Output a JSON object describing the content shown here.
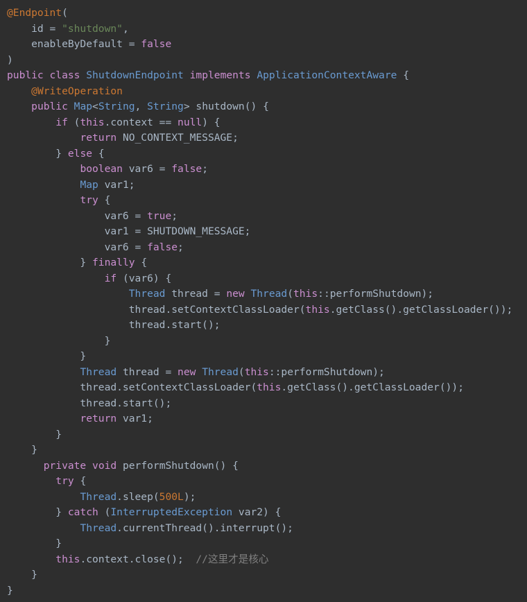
{
  "editor": {
    "language": "Java",
    "theme": "darcula",
    "background_color": "#2e2e2e",
    "colors": {
      "plain": "#a9b7c6",
      "keyword": "#cb8fd0",
      "type": "#6a9bd1",
      "annotation": "#cc7832",
      "string": "#6a8759",
      "number": "#cc7832",
      "comment": "#808080"
    }
  },
  "code": {
    "lines": [
      {
        "index": 1,
        "text": "@Endpoint(",
        "tokens": [
          {
            "t": "@Endpoint",
            "k": "anno"
          },
          {
            "t": "(",
            "k": "punct"
          }
        ]
      },
      {
        "index": 2,
        "text": "    id = \"shutdown\",",
        "tokens": [
          {
            "t": "    id = ",
            "k": "plain"
          },
          {
            "t": "\"shutdown\"",
            "k": "string"
          },
          {
            "t": ",",
            "k": "punct"
          }
        ]
      },
      {
        "index": 3,
        "text": "    enableByDefault = false",
        "tokens": [
          {
            "t": "    enableByDefault = ",
            "k": "plain"
          },
          {
            "t": "false",
            "k": "keyword"
          }
        ]
      },
      {
        "index": 4,
        "text": ")",
        "tokens": [
          {
            "t": ")",
            "k": "punct"
          }
        ]
      },
      {
        "index": 5,
        "text": "public class ShutdownEndpoint implements ApplicationContextAware {",
        "tokens": [
          {
            "t": "public",
            "k": "keyword"
          },
          {
            "t": " ",
            "k": "plain"
          },
          {
            "t": "class",
            "k": "keyword"
          },
          {
            "t": " ",
            "k": "plain"
          },
          {
            "t": "ShutdownEndpoint",
            "k": "type"
          },
          {
            "t": " ",
            "k": "plain"
          },
          {
            "t": "implements",
            "k": "keyword"
          },
          {
            "t": " ",
            "k": "plain"
          },
          {
            "t": "ApplicationContextAware",
            "k": "type"
          },
          {
            "t": " {",
            "k": "punct"
          }
        ]
      },
      {
        "index": 6,
        "text": "    @WriteOperation",
        "tokens": [
          {
            "t": "    ",
            "k": "plain"
          },
          {
            "t": "@WriteOperation",
            "k": "anno"
          }
        ]
      },
      {
        "index": 7,
        "text": "    public Map<String, String> shutdown() {",
        "tokens": [
          {
            "t": "    ",
            "k": "plain"
          },
          {
            "t": "public",
            "k": "keyword"
          },
          {
            "t": " ",
            "k": "plain"
          },
          {
            "t": "Map",
            "k": "type"
          },
          {
            "t": "<",
            "k": "punct"
          },
          {
            "t": "String",
            "k": "type"
          },
          {
            "t": ", ",
            "k": "punct"
          },
          {
            "t": "String",
            "k": "type"
          },
          {
            "t": "> shutdown() {",
            "k": "plain"
          }
        ]
      },
      {
        "index": 8,
        "text": "        if (this.context == null) {",
        "tokens": [
          {
            "t": "        ",
            "k": "plain"
          },
          {
            "t": "if",
            "k": "keyword"
          },
          {
            "t": " (",
            "k": "punct"
          },
          {
            "t": "this",
            "k": "keyword"
          },
          {
            "t": ".context == ",
            "k": "plain"
          },
          {
            "t": "null",
            "k": "keyword"
          },
          {
            "t": ") {",
            "k": "punct"
          }
        ]
      },
      {
        "index": 9,
        "text": "            return NO_CONTEXT_MESSAGE;",
        "tokens": [
          {
            "t": "            ",
            "k": "plain"
          },
          {
            "t": "return",
            "k": "keyword"
          },
          {
            "t": " NO_CONTEXT_MESSAGE;",
            "k": "plain"
          }
        ]
      },
      {
        "index": 10,
        "text": "        } else {",
        "tokens": [
          {
            "t": "        } ",
            "k": "plain"
          },
          {
            "t": "else",
            "k": "keyword"
          },
          {
            "t": " {",
            "k": "punct"
          }
        ]
      },
      {
        "index": 11,
        "text": "            boolean var6 = false;",
        "tokens": [
          {
            "t": "            ",
            "k": "plain"
          },
          {
            "t": "boolean",
            "k": "keyword"
          },
          {
            "t": " var6 = ",
            "k": "plain"
          },
          {
            "t": "false",
            "k": "keyword"
          },
          {
            "t": ";",
            "k": "punct"
          }
        ]
      },
      {
        "index": 12,
        "text": "            Map var1;",
        "tokens": [
          {
            "t": "            ",
            "k": "plain"
          },
          {
            "t": "Map",
            "k": "type"
          },
          {
            "t": " var1;",
            "k": "plain"
          }
        ]
      },
      {
        "index": 13,
        "text": "            try {",
        "tokens": [
          {
            "t": "            ",
            "k": "plain"
          },
          {
            "t": "try",
            "k": "keyword"
          },
          {
            "t": " {",
            "k": "punct"
          }
        ]
      },
      {
        "index": 14,
        "text": "                var6 = true;",
        "tokens": [
          {
            "t": "                var6 = ",
            "k": "plain"
          },
          {
            "t": "true",
            "k": "keyword"
          },
          {
            "t": ";",
            "k": "punct"
          }
        ]
      },
      {
        "index": 15,
        "text": "                var1 = SHUTDOWN_MESSAGE;",
        "tokens": [
          {
            "t": "                var1 = SHUTDOWN_MESSAGE;",
            "k": "plain"
          }
        ]
      },
      {
        "index": 16,
        "text": "                var6 = false;",
        "tokens": [
          {
            "t": "                var6 = ",
            "k": "plain"
          },
          {
            "t": "false",
            "k": "keyword"
          },
          {
            "t": ";",
            "k": "punct"
          }
        ]
      },
      {
        "index": 17,
        "text": "            } finally {",
        "tokens": [
          {
            "t": "            } ",
            "k": "plain"
          },
          {
            "t": "finally",
            "k": "keyword"
          },
          {
            "t": " {",
            "k": "punct"
          }
        ]
      },
      {
        "index": 18,
        "text": "                if (var6) {",
        "tokens": [
          {
            "t": "                ",
            "k": "plain"
          },
          {
            "t": "if",
            "k": "keyword"
          },
          {
            "t": " (var6) {",
            "k": "plain"
          }
        ]
      },
      {
        "index": 19,
        "text": "                    Thread thread = new Thread(this::performShutdown);",
        "tokens": [
          {
            "t": "                    ",
            "k": "plain"
          },
          {
            "t": "Thread",
            "k": "type"
          },
          {
            "t": " thread = ",
            "k": "plain"
          },
          {
            "t": "new",
            "k": "keyword"
          },
          {
            "t": " ",
            "k": "plain"
          },
          {
            "t": "Thread",
            "k": "type"
          },
          {
            "t": "(",
            "k": "punct"
          },
          {
            "t": "this",
            "k": "keyword"
          },
          {
            "t": "::performShutdown);",
            "k": "plain"
          }
        ]
      },
      {
        "index": 20,
        "text": "                    thread.setContextClassLoader(this.getClass().getClassLoader());",
        "tokens": [
          {
            "t": "                    thread.setContextClassLoader(",
            "k": "plain"
          },
          {
            "t": "this",
            "k": "keyword"
          },
          {
            "t": ".getClass().getClassLoader());",
            "k": "plain"
          }
        ]
      },
      {
        "index": 21,
        "text": "                    thread.start();",
        "tokens": [
          {
            "t": "                    thread.start();",
            "k": "plain"
          }
        ]
      },
      {
        "index": 22,
        "text": "                }",
        "tokens": [
          {
            "t": "                }",
            "k": "plain"
          }
        ]
      },
      {
        "index": 23,
        "text": "            }",
        "tokens": [
          {
            "t": "            }",
            "k": "plain"
          }
        ]
      },
      {
        "index": 24,
        "text": "            Thread thread = new Thread(this::performShutdown);",
        "tokens": [
          {
            "t": "            ",
            "k": "plain"
          },
          {
            "t": "Thread",
            "k": "type"
          },
          {
            "t": " thread = ",
            "k": "plain"
          },
          {
            "t": "new",
            "k": "keyword"
          },
          {
            "t": " ",
            "k": "plain"
          },
          {
            "t": "Thread",
            "k": "type"
          },
          {
            "t": "(",
            "k": "punct"
          },
          {
            "t": "this",
            "k": "keyword"
          },
          {
            "t": "::performShutdown);",
            "k": "plain"
          }
        ]
      },
      {
        "index": 25,
        "text": "            thread.setContextClassLoader(this.getClass().getClassLoader());",
        "tokens": [
          {
            "t": "            thread.setContextClassLoader(",
            "k": "plain"
          },
          {
            "t": "this",
            "k": "keyword"
          },
          {
            "t": ".getClass().getClassLoader());",
            "k": "plain"
          }
        ]
      },
      {
        "index": 26,
        "text": "            thread.start();",
        "tokens": [
          {
            "t": "            thread.start();",
            "k": "plain"
          }
        ]
      },
      {
        "index": 27,
        "text": "            return var1;",
        "tokens": [
          {
            "t": "            ",
            "k": "plain"
          },
          {
            "t": "return",
            "k": "keyword"
          },
          {
            "t": " var1;",
            "k": "plain"
          }
        ]
      },
      {
        "index": 28,
        "text": "        }",
        "tokens": [
          {
            "t": "        }",
            "k": "plain"
          }
        ]
      },
      {
        "index": 29,
        "text": "    }",
        "tokens": [
          {
            "t": "    }",
            "k": "plain"
          }
        ]
      },
      {
        "index": 30,
        "text": "      private void performShutdown() {",
        "tokens": [
          {
            "t": "      ",
            "k": "plain"
          },
          {
            "t": "private",
            "k": "keyword"
          },
          {
            "t": " ",
            "k": "plain"
          },
          {
            "t": "void",
            "k": "keyword"
          },
          {
            "t": " performShutdown() {",
            "k": "plain"
          }
        ]
      },
      {
        "index": 31,
        "text": "        try {",
        "tokens": [
          {
            "t": "        ",
            "k": "plain"
          },
          {
            "t": "try",
            "k": "keyword"
          },
          {
            "t": " {",
            "k": "punct"
          }
        ]
      },
      {
        "index": 32,
        "text": "            Thread.sleep(500L);",
        "tokens": [
          {
            "t": "            ",
            "k": "plain"
          },
          {
            "t": "Thread",
            "k": "type"
          },
          {
            "t": ".sleep(",
            "k": "plain"
          },
          {
            "t": "500L",
            "k": "number"
          },
          {
            "t": ");",
            "k": "plain"
          }
        ]
      },
      {
        "index": 33,
        "text": "        } catch (InterruptedException var2) {",
        "tokens": [
          {
            "t": "        } ",
            "k": "plain"
          },
          {
            "t": "catch",
            "k": "keyword"
          },
          {
            "t": " (",
            "k": "punct"
          },
          {
            "t": "InterruptedException",
            "k": "type"
          },
          {
            "t": " var2) {",
            "k": "plain"
          }
        ]
      },
      {
        "index": 34,
        "text": "            Thread.currentThread().interrupt();",
        "tokens": [
          {
            "t": "            ",
            "k": "plain"
          },
          {
            "t": "Thread",
            "k": "type"
          },
          {
            "t": ".currentThread().interrupt();",
            "k": "plain"
          }
        ]
      },
      {
        "index": 35,
        "text": "        }",
        "tokens": [
          {
            "t": "        }",
            "k": "plain"
          }
        ]
      },
      {
        "index": 36,
        "text": "        this.context.close();  //这里才是核心",
        "tokens": [
          {
            "t": "        ",
            "k": "plain"
          },
          {
            "t": "this",
            "k": "keyword"
          },
          {
            "t": ".context.close();  ",
            "k": "plain"
          },
          {
            "t": "//这里才是核心",
            "k": "comment"
          }
        ]
      },
      {
        "index": 37,
        "text": "    }",
        "tokens": [
          {
            "t": "    }",
            "k": "plain"
          }
        ]
      },
      {
        "index": 38,
        "text": "}",
        "tokens": [
          {
            "t": "}",
            "k": "plain"
          }
        ]
      }
    ]
  }
}
